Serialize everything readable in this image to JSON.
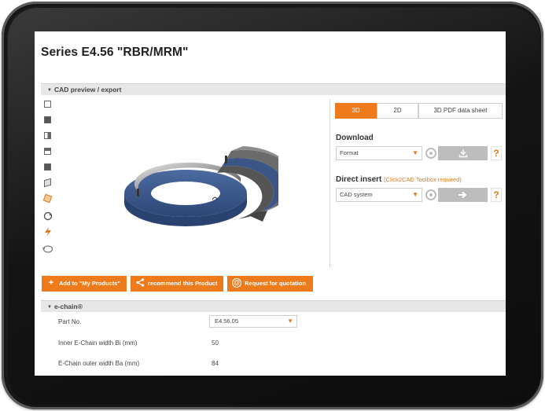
{
  "page": {
    "title": "Series E4.56 \"RBR/MRM\""
  },
  "cad_section": {
    "header": "CAD preview / export",
    "view_tools": [
      "view-front-icon",
      "view-back-icon",
      "view-left-icon",
      "view-top-icon",
      "view-bottom-icon",
      "view-right-icon",
      "view-iso-icon",
      "rotate-icon",
      "flash-icon",
      "view-360-icon"
    ]
  },
  "tabs": [
    {
      "label": "3D",
      "active": true
    },
    {
      "label": "2D",
      "active": false
    },
    {
      "label": "3D PDF data sheet",
      "active": false
    }
  ],
  "download": {
    "label": "Download",
    "format_value": "Format",
    "help": "?"
  },
  "direct_insert": {
    "label": "Direct insert",
    "hint": "(Click2CAD Toolbox required)",
    "system_value": "CAD system",
    "help": "?"
  },
  "actions": {
    "add_label": "Add to \"My Products\"",
    "recommend_label": "recommend this Product",
    "quote_label": "Request for quotation"
  },
  "echain": {
    "header": "e-chain®",
    "part_no_label": "Part No.",
    "part_no_value": "E4.56.05",
    "inner_label": "Inner E-Chain width Bi (mm)",
    "inner_value": "50",
    "outer_label": "E-Chain outer width Ba (mm)",
    "outer_value": "84"
  },
  "colors": {
    "accent": "#ed7b1c",
    "ring_blue": "#3d5a8a",
    "ring_grey": "#5c5c5c"
  }
}
